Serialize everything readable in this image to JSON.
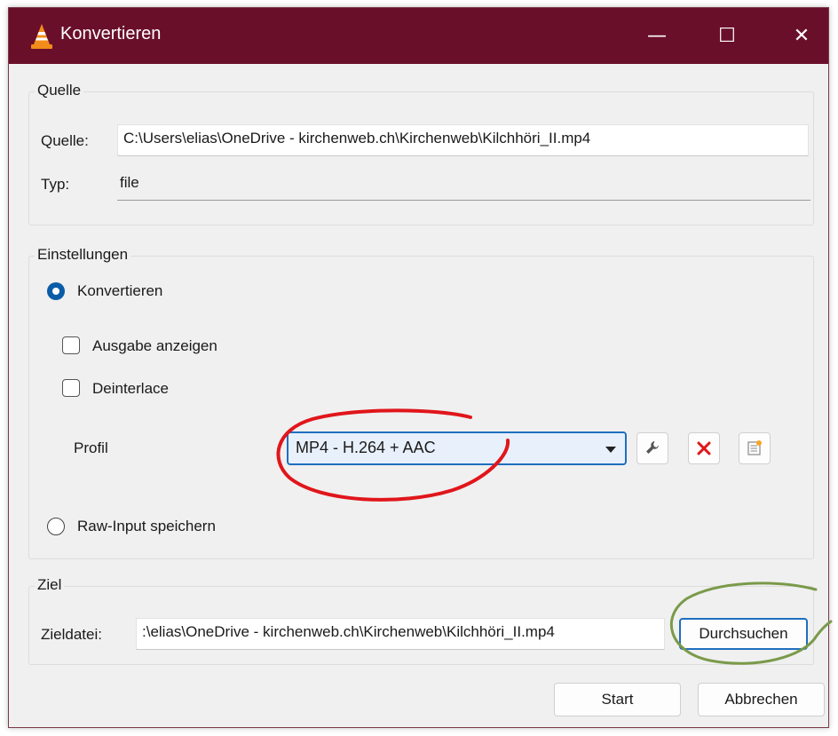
{
  "window": {
    "title": "Konvertieren"
  },
  "titlebar": {
    "minimize_glyph": "—",
    "maximize_glyph": "☐",
    "close_glyph": "✕"
  },
  "source": {
    "group_label": "Quelle",
    "source_label": "Quelle:",
    "source_value": "C:\\Users\\elias\\OneDrive - kirchenweb.ch\\Kirchenweb\\Kilchhöri_II.mp4",
    "type_label": "Typ:",
    "type_value": "file"
  },
  "settings": {
    "group_label": "Einstellungen",
    "convert_label": "Konvertieren",
    "convert_selected": true,
    "show_output_label": "Ausgabe anzeigen",
    "show_output_checked": false,
    "deinterlace_label": "Deinterlace",
    "deinterlace_checked": false,
    "profile_label": "Profil",
    "profile_value": "MP4 - H.264 + AAC",
    "edit_profile_icon": "wrench-icon",
    "delete_profile_icon": "red-x-icon",
    "new_profile_icon": "new-profile-icon",
    "raw_input_label": "Raw-Input speichern",
    "raw_input_selected": false
  },
  "destination": {
    "group_label": "Ziel",
    "file_label": "Zieldatei:",
    "file_value": ":\\elias\\OneDrive - kirchenweb.ch\\Kirchenweb\\Kilchhöri_II.mp4",
    "browse_label": "Durchsuchen"
  },
  "buttons": {
    "start_label": "Start",
    "cancel_label": "Abbrechen"
  },
  "colors": {
    "titlebar": "#6a0f2a",
    "accent": "#1f6fbf",
    "annotation_red": "#e0161b",
    "annotation_green": "#7a9a4a"
  }
}
